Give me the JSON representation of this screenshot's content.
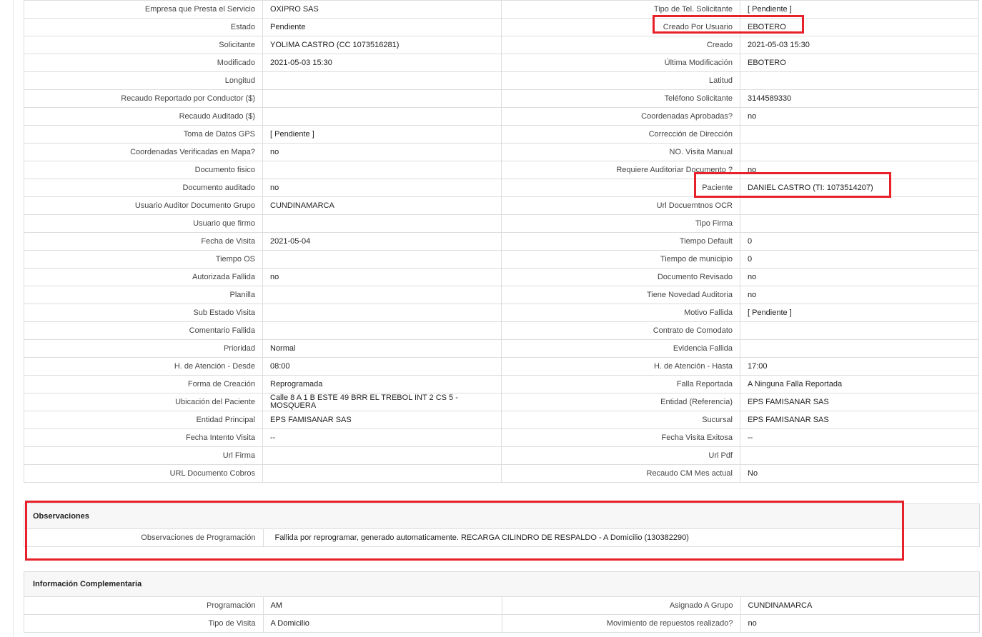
{
  "rows": [
    {
      "l1": "Empresa que Presta el Servicio",
      "v1": "OXIPRO SAS",
      "l2": "Tipo de Tel. Solicitante",
      "v2": "[ Pendiente ]"
    },
    {
      "l1": "Estado",
      "v1": "Pendiente",
      "l2": "Creado Por Usuario",
      "v2": "EBOTERO"
    },
    {
      "l1": "Solicitante",
      "v1": "YOLIMA CASTRO (CC 1073516281)",
      "l2": "Creado",
      "v2": "2021-05-03 15:30"
    },
    {
      "l1": "Modificado",
      "v1": "2021-05-03 15:30",
      "l2": "Última Modificación",
      "v2": "EBOTERO"
    },
    {
      "l1": "Longitud",
      "v1": "",
      "l2": "Latitud",
      "v2": ""
    },
    {
      "l1": "Recaudo Reportado por Conductor ($)",
      "v1": "",
      "l2": "Teléfono Solicitante",
      "v2": "3144589330"
    },
    {
      "l1": "Recaudo Auditado ($)",
      "v1": "",
      "l2": "Coordenadas Aprobadas?",
      "v2": "no"
    },
    {
      "l1": "Toma de Datos GPS",
      "v1": "[ Pendiente ]",
      "l2": "Corrección de Dirección",
      "v2": ""
    },
    {
      "l1": "Coordenadas Verificadas en Mapa?",
      "v1": "no",
      "l2": "NO. Visita Manual",
      "v2": ""
    },
    {
      "l1": "Documento fisico",
      "v1": "",
      "l2": "Requiere Auditoriar Documento ?",
      "v2": "no"
    },
    {
      "l1": "Documento auditado",
      "v1": "no",
      "l2": "Paciente",
      "v2": "DANIEL CASTRO (TI: 1073514207)"
    },
    {
      "l1": "Usuario Auditor Documento Grupo",
      "v1": "CUNDINAMARCA",
      "l2": "Url Docuemtnos OCR",
      "v2": ""
    },
    {
      "l1": "Usuario que firmo",
      "v1": "",
      "l2": "Tipo Firma",
      "v2": ""
    },
    {
      "l1": "Fecha de Visita",
      "v1": "2021-05-04",
      "l2": "Tiempo Default",
      "v2": "0"
    },
    {
      "l1": "Tiempo OS",
      "v1": "",
      "l2": "Tiempo de municipio",
      "v2": "0"
    },
    {
      "l1": "Autorizada Fallida",
      "v1": "no",
      "l2": "Documento Revisado",
      "v2": "no"
    },
    {
      "l1": "Planilla",
      "v1": "",
      "l2": "Tiene Novedad Auditoria",
      "v2": "no"
    },
    {
      "l1": "Sub Estado Visita",
      "v1": "",
      "l2": "Motivo Fallida",
      "v2": "[ Pendiente ]"
    },
    {
      "l1": "Comentario Fallida",
      "v1": "",
      "l2": "Contrato de Comodato",
      "v2": ""
    },
    {
      "l1": "Prioridad",
      "v1": "Normal",
      "l2": "Evidencia Fallida",
      "v2": ""
    },
    {
      "l1": "H. de Atención - Desde",
      "v1": "08:00",
      "l2": "H. de Atención - Hasta",
      "v2": "17:00"
    },
    {
      "l1": "Forma de Creación",
      "v1": "Reprogramada",
      "l2": "Falla Reportada",
      "v2": "A Ninguna Falla Reportada"
    },
    {
      "l1": "Ubicación del Paciente",
      "v1": "Calle 8 A 1 B ESTE 49 BRR EL TREBOL INT 2 CS 5 - MOSQUERA",
      "l2": "Entidad (Referencia)",
      "v2": "EPS FAMISANAR SAS"
    },
    {
      "l1": "Entidad Principal",
      "v1": "EPS FAMISANAR SAS",
      "l2": "Sucursal",
      "v2": "EPS FAMISANAR SAS"
    },
    {
      "l1": "Fecha Intento Visita",
      "v1": "--",
      "l2": "Fecha Visita Exitosa",
      "v2": "--"
    },
    {
      "l1": "Url Firma",
      "v1": "",
      "l2": "Url Pdf",
      "v2": ""
    },
    {
      "l1": "URL Documento Cobros",
      "v1": "",
      "l2": "Recaudo CM Mes actual",
      "v2": "No"
    }
  ],
  "observaciones": {
    "title": "Observaciones",
    "label": "Observaciones de Programación",
    "value": "Fallida por reprogramar, generado automaticamente. RECARGA CILINDRO DE RESPALDO - A Domicilio (130382290)"
  },
  "complementaria": {
    "title": "Información Complementaria",
    "rows": [
      {
        "l1": "Programación",
        "v1": "AM",
        "l2": "Asignado A Grupo",
        "v2": "CUNDINAMARCA"
      },
      {
        "l1": "Tipo de Visita",
        "v1": "A Domicilio",
        "l2": "Movimiento de repuestos realizado?",
        "v2": "no"
      }
    ]
  },
  "highlight_color": "#e8202a"
}
